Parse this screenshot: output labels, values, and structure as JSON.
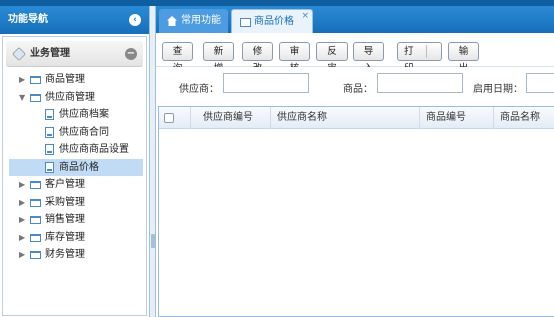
{
  "sidebar": {
    "title": "功能导航",
    "panel_title": "业务管理",
    "tree": [
      {
        "label": "商品管理",
        "type": "folder",
        "level": 0,
        "expanded": false
      },
      {
        "label": "供应商管理",
        "type": "folder",
        "level": 0,
        "expanded": true
      },
      {
        "label": "供应商档案",
        "type": "doc",
        "level": 1
      },
      {
        "label": "供应商合同",
        "type": "doc",
        "level": 1
      },
      {
        "label": "供应商商品设置",
        "type": "doc",
        "level": 1
      },
      {
        "label": "商品价格",
        "type": "doc",
        "level": 1,
        "selected": true
      },
      {
        "label": "客户管理",
        "type": "folder",
        "level": 0,
        "expanded": false
      },
      {
        "label": "采购管理",
        "type": "folder",
        "level": 0,
        "expanded": false
      },
      {
        "label": "销售管理",
        "type": "folder",
        "level": 0,
        "expanded": false
      },
      {
        "label": "库存管理",
        "type": "folder",
        "level": 0,
        "expanded": false
      },
      {
        "label": "财务管理",
        "type": "folder",
        "level": 0,
        "expanded": false
      }
    ]
  },
  "tabs": [
    {
      "label": "常用功能",
      "icon": "home-icon"
    },
    {
      "label": "商品价格",
      "icon": "window-icon",
      "close": "×"
    }
  ],
  "toolbar": {
    "query": "查询",
    "add": "新增",
    "edit": "修改",
    "review": "审核",
    "unreview": "反审",
    "import": "导入",
    "print": "打印",
    "export": "输出"
  },
  "filters": {
    "supplier_label": "供应商：",
    "supplier_value": "",
    "product_label": "商品：",
    "product_value": "",
    "enable_date_label": "启用日期：",
    "enable_date_value": ""
  },
  "grid": {
    "columns": [
      "供应商编号",
      "供应商名称",
      "商品编号",
      "商品名称"
    ],
    "rows": []
  },
  "colors": {
    "header_blue": "#1670b8",
    "selected_row": "#c2dbf5",
    "accent": "#2b8ad6"
  }
}
